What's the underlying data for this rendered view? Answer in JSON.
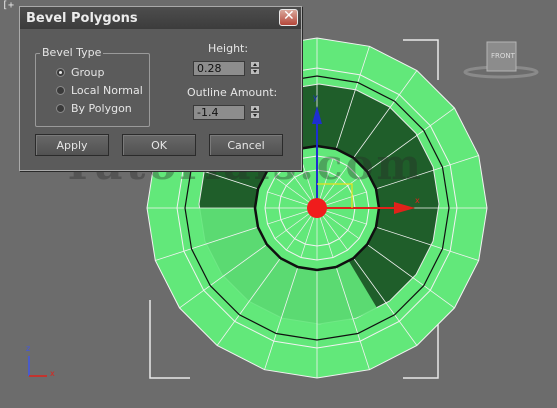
{
  "viewport": {
    "corner_label": "[+",
    "watermark": "Tutorials.com",
    "viewcube_label": "FRONT",
    "axis_labels": {
      "x": "x",
      "y": "y",
      "z": "z"
    },
    "colors": {
      "background": "#6c6c6c",
      "geometry_light": "#62e87a",
      "geometry_dark": "#1f5e2a",
      "gizmo_x": "#e0221a",
      "gizmo_y": "#1d2fd0",
      "pivot": "#f01c1c"
    }
  },
  "dialog": {
    "title": "Bevel Polygons",
    "bevel_type": {
      "legend": "Bevel Type",
      "options": [
        {
          "label": "Group",
          "checked": true
        },
        {
          "label": "Local Normal",
          "checked": false
        },
        {
          "label": "By Polygon",
          "checked": false
        }
      ]
    },
    "height": {
      "label": "Height:",
      "value": "0.28"
    },
    "outline": {
      "label": "Outline Amount:",
      "value": "-1.4"
    },
    "buttons": {
      "apply": "Apply",
      "ok": "OK",
      "cancel": "Cancel"
    }
  }
}
